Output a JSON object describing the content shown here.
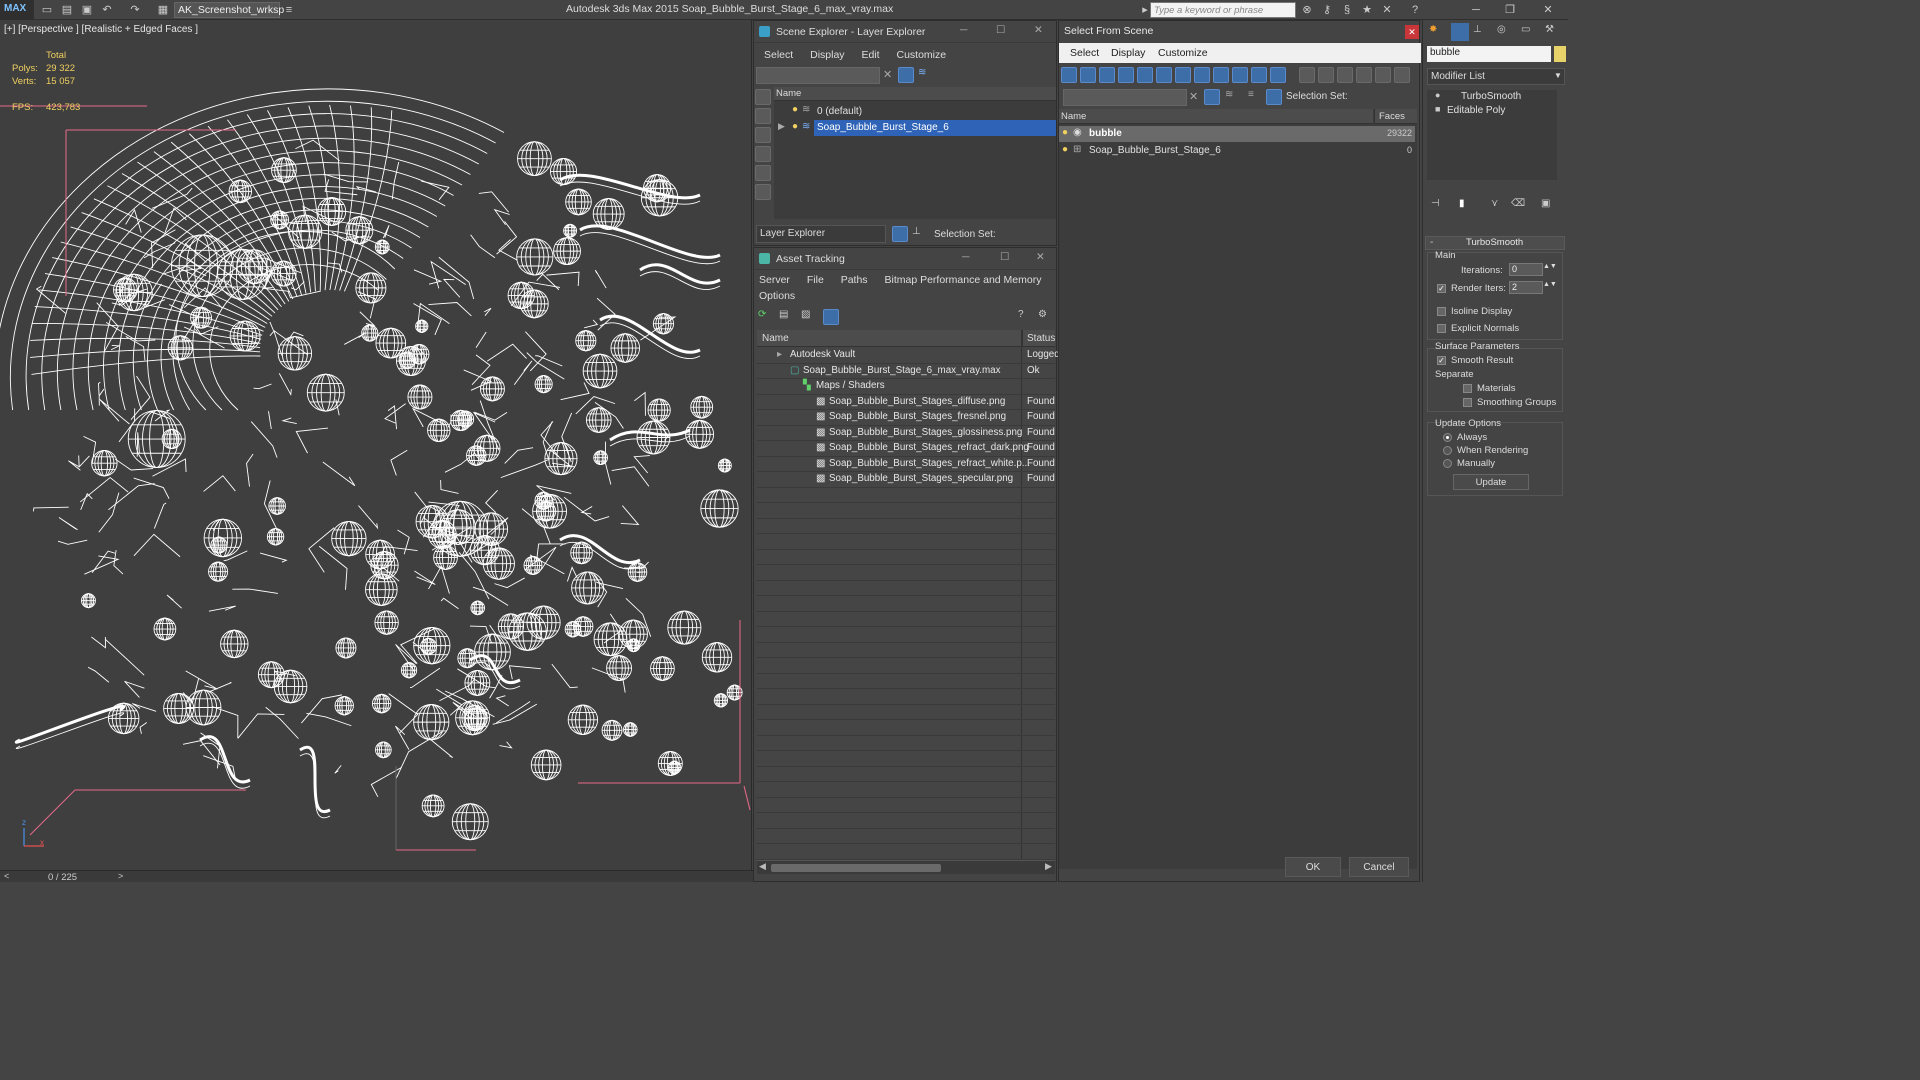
{
  "app": {
    "logo_text": "MAX",
    "title": "Autodesk 3ds Max  2015    Soap_Bubble_Burst_Stage_6_max_vray.max",
    "workspace": "AK_Screenshot_wrksp",
    "search_placeholder": "Type a keyword or phrase"
  },
  "viewport": {
    "label": "[+] [Perspective ] [Realistic + Edged Faces ]",
    "stats": {
      "total_label": "Total",
      "polys_label": "Polys:",
      "polys_value": "29 322",
      "verts_label": "Verts:",
      "verts_value": "15 057",
      "fps_label": "FPS:",
      "fps_value": "423,783"
    },
    "axis": {
      "z": "z",
      "x": "x"
    }
  },
  "timeline": {
    "value": "0 / 225",
    "prev": "<",
    "next": ">"
  },
  "scene_explorer": {
    "title": "Scene Explorer - Layer Explorer",
    "menu": [
      "Select",
      "Display",
      "Edit",
      "Customize"
    ],
    "col_name": "Name",
    "layers": [
      {
        "name": "0 (default)",
        "selected": false
      },
      {
        "name": "Soap_Bubble_Burst_Stage_6",
        "selected": true
      }
    ],
    "footer_dropdown": "Layer Explorer",
    "footer_selection_set": "Selection Set:"
  },
  "asset_tracking": {
    "title": "Asset Tracking",
    "menu_row1": [
      "Server",
      "File",
      "Paths",
      "Bitmap Performance and Memory"
    ],
    "menu_row2": [
      "Options"
    ],
    "col_name": "Name",
    "col_status": "Status",
    "rows": [
      {
        "name": "Autodesk Vault",
        "status": "Logged",
        "indent": 0
      },
      {
        "name": "Soap_Bubble_Burst_Stage_6_max_vray.max",
        "status": "Ok",
        "indent": 1
      },
      {
        "name": "Maps / Shaders",
        "status": "",
        "indent": 2
      },
      {
        "name": "Soap_Bubble_Burst_Stages_diffuse.png",
        "status": "Found",
        "indent": 3
      },
      {
        "name": "Soap_Bubble_Burst_Stages_fresnel.png",
        "status": "Found",
        "indent": 3
      },
      {
        "name": "Soap_Bubble_Burst_Stages_glossiness.png",
        "status": "Found",
        "indent": 3
      },
      {
        "name": "Soap_Bubble_Burst_Stages_refract_dark.png",
        "status": "Found",
        "indent": 3
      },
      {
        "name": "Soap_Bubble_Burst_Stages_refract_white.p...",
        "status": "Found",
        "indent": 3
      },
      {
        "name": "Soap_Bubble_Burst_Stages_specular.png",
        "status": "Found",
        "indent": 3
      }
    ]
  },
  "select_from_scene": {
    "title": "Select From Scene",
    "menu": [
      "Select",
      "Display",
      "Customize"
    ],
    "selection_set": "Selection Set:",
    "col_name": "Name",
    "col_faces": "Faces",
    "rows": [
      {
        "name": "bubble",
        "faces": "29322",
        "selected": true
      },
      {
        "name": "Soap_Bubble_Burst_Stage_6",
        "faces": "0",
        "selected": false
      }
    ],
    "ok": "OK",
    "cancel": "Cancel"
  },
  "command_panel": {
    "object_name": "bubble",
    "modifier_list": "Modifier List",
    "stack": [
      "TurboSmooth",
      "Editable Poly"
    ],
    "rollout_title": "TurboSmooth",
    "main_group": "Main",
    "iterations_label": "Iterations:",
    "iterations_value": "0",
    "render_iters_label": "Render Iters:",
    "render_iters_value": "2",
    "render_iters_checked": true,
    "isoline_label": "Isoline Display",
    "explicit_normals_label": "Explicit Normals",
    "surface_group": "Surface Parameters",
    "smooth_result_label": "Smooth Result",
    "separate_label": "Separate",
    "materials_label": "Materials",
    "smoothing_groups_label": "Smoothing Groups",
    "update_group": "Update Options",
    "always_label": "Always",
    "when_rendering_label": "When Rendering",
    "manually_label": "Manually",
    "update_button": "Update"
  },
  "colors": {
    "accent": "#3d6ea8",
    "selection": "#2f63b8",
    "stat_yellow": "#f0d060",
    "wire": "#ffffff",
    "viewport_bg": "#3f3f3f"
  }
}
